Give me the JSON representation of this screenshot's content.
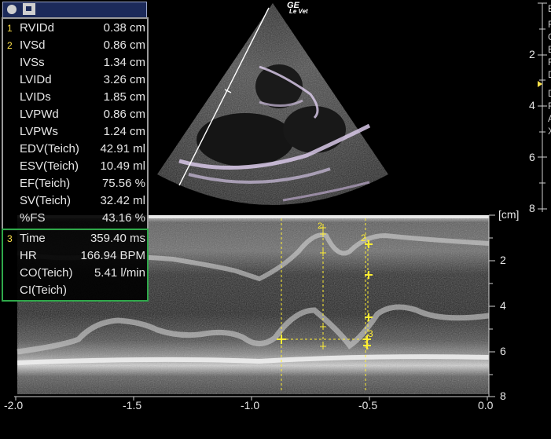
{
  "header": {
    "brand": "GE",
    "subbrand": "Le Vet"
  },
  "panel_icons": [
    "record-icon",
    "camera-icon"
  ],
  "measurements_group1": [
    {
      "num": "1",
      "label": "RVIDd",
      "value": "0.38 cm"
    },
    {
      "num": "2",
      "label": "IVSd",
      "value": "0.86 cm"
    },
    {
      "num": "",
      "label": "IVSs",
      "value": "1.34 cm"
    },
    {
      "num": "",
      "label": "LVIDd",
      "value": "3.26 cm"
    },
    {
      "num": "",
      "label": "LVIDs",
      "value": "1.85 cm"
    },
    {
      "num": "",
      "label": "LVPWd",
      "value": "0.86 cm"
    },
    {
      "num": "",
      "label": "LVPWs",
      "value": "1.24 cm"
    },
    {
      "num": "",
      "label": "EDV(Teich)",
      "value": "42.91 ml"
    },
    {
      "num": "",
      "label": "ESV(Teich)",
      "value": "10.49 ml"
    },
    {
      "num": "",
      "label": "EF(Teich)",
      "value": "75.56 %"
    },
    {
      "num": "",
      "label": "SV(Teich)",
      "value": "32.42 ml"
    },
    {
      "num": "",
      "label": "%FS",
      "value": "43.16 %"
    }
  ],
  "measurements_group2": [
    {
      "num": "3",
      "label": "Time",
      "value": "359.40 ms"
    },
    {
      "num": "",
      "label": "HR",
      "value": "166.94 BPM"
    },
    {
      "num": "",
      "label": "CO(Teich)",
      "value": "5.41 l/min"
    },
    {
      "num": "",
      "label": "CI(Teich)",
      "value": ""
    }
  ],
  "depth_scale_2d": [
    "2",
    "4",
    "6",
    "8"
  ],
  "depth_scale_mmode": {
    "unit": "[cm]",
    "ticks": [
      "2",
      "4",
      "6",
      "8"
    ]
  },
  "time_axis": [
    "-2.0",
    "-1.5",
    "-1.0",
    "-0.5",
    "0.0"
  ],
  "markers": [
    "2",
    "2",
    "3"
  ],
  "right_edge_letters": [
    "B",
    "F",
    "G",
    "E",
    "F",
    "D",
    "D",
    "F",
    "A",
    "X"
  ],
  "colors": {
    "caliper": "#ffee33",
    "panel_border": "#9a9a9a",
    "group3_border": "#2fa84a",
    "header_bg": "#1c2a5a"
  }
}
